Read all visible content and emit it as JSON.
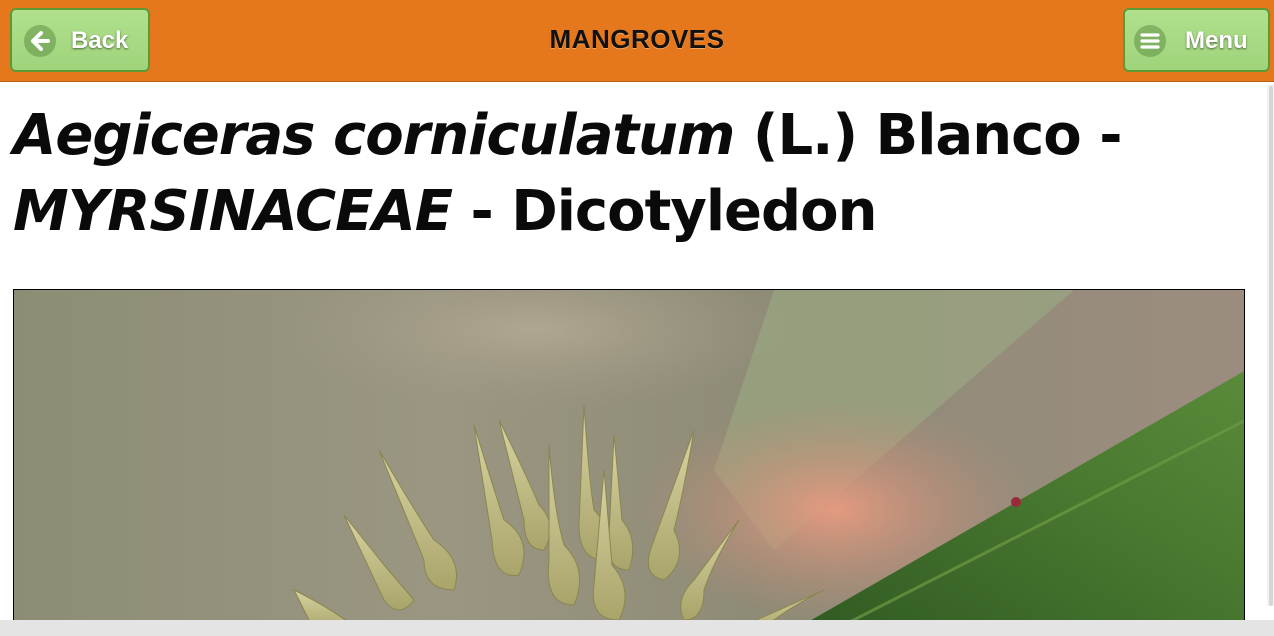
{
  "header": {
    "title": "MANGROVES",
    "back_label": "Back",
    "menu_label": "Menu",
    "back_icon": "arrow-left-circle-icon",
    "menu_icon": "hamburger-circle-icon",
    "bar_color": "#e5781c",
    "button_color": "#a5d881"
  },
  "species": {
    "genus_species": "Aegiceras corniculatum",
    "authority": " (L.) Blanco - ",
    "family": "MYRSINACEAE",
    "class": " - Dicotyledon"
  },
  "photo": {
    "subject": "flower-buds-photo"
  }
}
